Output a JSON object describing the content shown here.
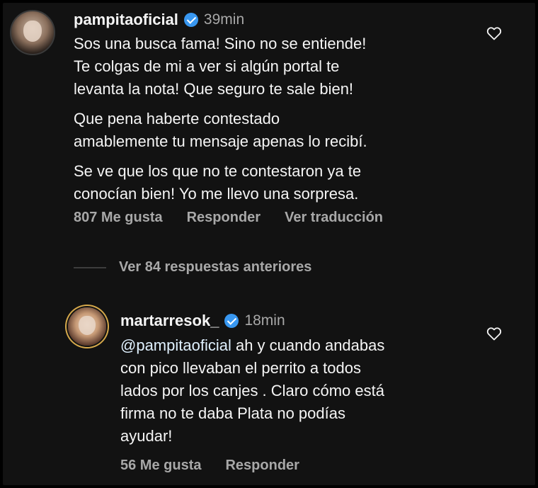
{
  "comment": {
    "username": "pampitaoficial",
    "time": "39min",
    "paragraphs": [
      "Sos una busca fama! Sino no se entiende!\nTe colgas de mi a ver si algún portal te\nlevanta la nota! Que seguro te sale bien!",
      "Que pena haberte contestado\namablemente tu mensaje apenas lo recibí.",
      "Se ve que los que no te contestaron ya te\nconocían bien! Yo me llevo una sorpresa."
    ],
    "likes": "807 Me gusta",
    "reply_label": "Responder",
    "translate_label": "Ver traducción"
  },
  "view_previous_replies": "Ver 84 respuestas anteriores",
  "reply": {
    "username": "martarresok_",
    "time": "18min",
    "mention": "@pampitaoficial",
    "text": " ah y cuando andabas\ncon pico llevaban el perrito a todos\nlados por los canjes . Claro cómo está\nfirma no te daba Plata no podías\nayudar!",
    "likes": "56 Me gusta",
    "reply_label": "Responder"
  },
  "colors": {
    "background": "#121212",
    "text": "#f5f5f5",
    "secondary_text": "#a8a8a8",
    "verified": "#3897f0"
  },
  "icons": {
    "verified": "verified-badge-icon",
    "like": "heart-outline-icon"
  }
}
